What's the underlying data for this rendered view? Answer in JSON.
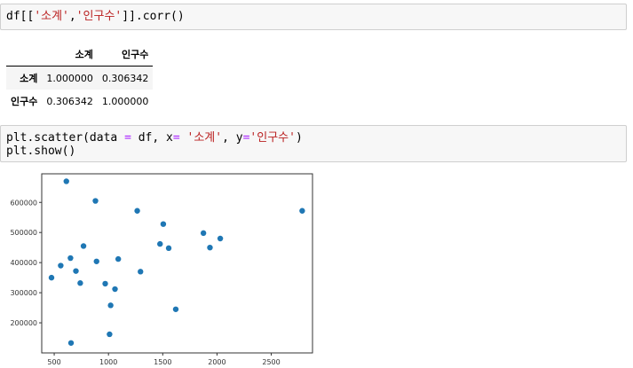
{
  "cells": [
    {
      "code_lines": [
        [
          {
            "t": "df[["
          },
          {
            "t": "'소계'",
            "cls": "str"
          },
          {
            "t": ","
          },
          {
            "t": "'인구수'",
            "cls": "str"
          },
          {
            "t": "]].corr()"
          }
        ]
      ]
    },
    {
      "code_lines": [
        [
          {
            "t": "plt.scatter(data "
          },
          {
            "t": "=",
            "cls": "op"
          },
          {
            "t": " df, x"
          },
          {
            "t": "=",
            "cls": "op"
          },
          {
            "t": " "
          },
          {
            "t": "'소계'",
            "cls": "str"
          },
          {
            "t": ", y"
          },
          {
            "t": "=",
            "cls": "op"
          },
          {
            "t": "'인구수'",
            "cls": "str"
          },
          {
            "t": ")"
          }
        ],
        [
          {
            "t": "plt.show()"
          }
        ]
      ]
    }
  ],
  "corr_table": {
    "columns": [
      "",
      "소계",
      "인구수"
    ],
    "rows": [
      {
        "index": "소계",
        "values": [
          "1.000000",
          "0.306342"
        ]
      },
      {
        "index": "인구수",
        "values": [
          "0.306342",
          "1.000000"
        ]
      }
    ]
  },
  "chart_data": {
    "type": "scatter",
    "title": "",
    "xlabel": "",
    "ylabel": "",
    "xlim": [
      385,
      2880
    ],
    "ylim": [
      100000,
      695000
    ],
    "xticks": [
      500,
      1000,
      1500,
      2000,
      2500
    ],
    "xtick_labels": [
      "500",
      "1000",
      "1500",
      "2000",
      "2500"
    ],
    "yticks": [
      200000,
      300000,
      400000,
      500000,
      600000
    ],
    "ytick_labels": [
      "200000",
      "300000",
      "400000",
      "500000",
      "600000"
    ],
    "grid": false,
    "marker_color": "#1f77b4",
    "points": [
      [
        612,
        670000
      ],
      [
        880,
        605000
      ],
      [
        1265,
        572000
      ],
      [
        2785,
        572000
      ],
      [
        1505,
        528000
      ],
      [
        1875,
        498000
      ],
      [
        2030,
        480000
      ],
      [
        1475,
        462000
      ],
      [
        770,
        455000
      ],
      [
        1555,
        448000
      ],
      [
        1935,
        450000
      ],
      [
        1090,
        412000
      ],
      [
        650,
        415000
      ],
      [
        890,
        404000
      ],
      [
        560,
        390000
      ],
      [
        700,
        372000
      ],
      [
        1295,
        370000
      ],
      [
        475,
        350000
      ],
      [
        740,
        332000
      ],
      [
        970,
        330000
      ],
      [
        1060,
        312000
      ],
      [
        1020,
        258000
      ],
      [
        1620,
        245000
      ],
      [
        1010,
        162000
      ],
      [
        655,
        133000
      ]
    ]
  }
}
